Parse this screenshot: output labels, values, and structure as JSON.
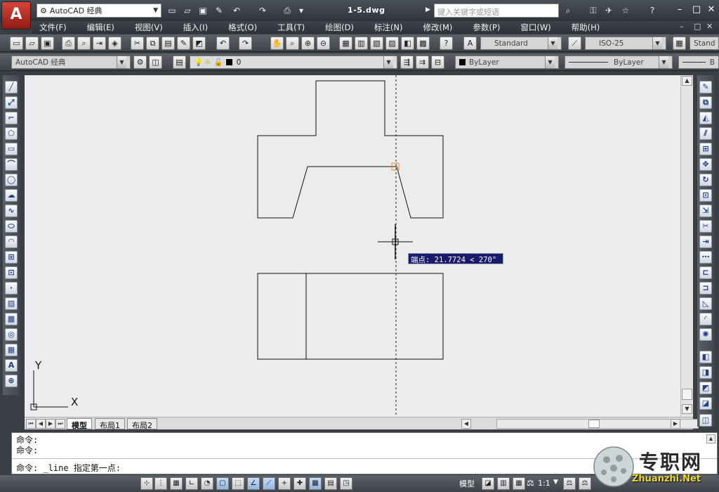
{
  "app": {
    "logo": "A",
    "workspace": "AutoCAD 经典",
    "file_title": "1-5.dwg",
    "search_placeholder": "键入关键字或短语"
  },
  "menu": [
    "文件(F)",
    "编辑(E)",
    "视图(V)",
    "插入(I)",
    "格式(O)",
    "工具(T)",
    "绘图(D)",
    "标注(N)",
    "修改(M)",
    "参数(P)",
    "窗口(W)",
    "帮助(H)"
  ],
  "toolbar": {
    "text_style": "Standard",
    "dim_style": "ISO-25",
    "table_style": "Stand",
    "workspace2": "AutoCAD 经典",
    "layer": "0",
    "color": "ByLayer",
    "linetype": "ByLayer",
    "lineweight": "B"
  },
  "tabs": [
    "模型",
    "布局1",
    "布局2"
  ],
  "command": {
    "line1": "命令:",
    "line2": "命令:",
    "line3": "命令: _line 指定第一点:"
  },
  "tooltip": "端点: 21.7724 < 270°",
  "ucs": {
    "x_label": "X",
    "y_label": "Y"
  },
  "status": {
    "model_label": "模型",
    "scale": "1:1"
  },
  "watermark": {
    "brand": "专职网",
    "url": "Zhuanzhi.Net"
  },
  "colors": {
    "accent": "#d9443a",
    "tooltip_bg": "#1a1a6e",
    "canvas": "#ececec"
  }
}
